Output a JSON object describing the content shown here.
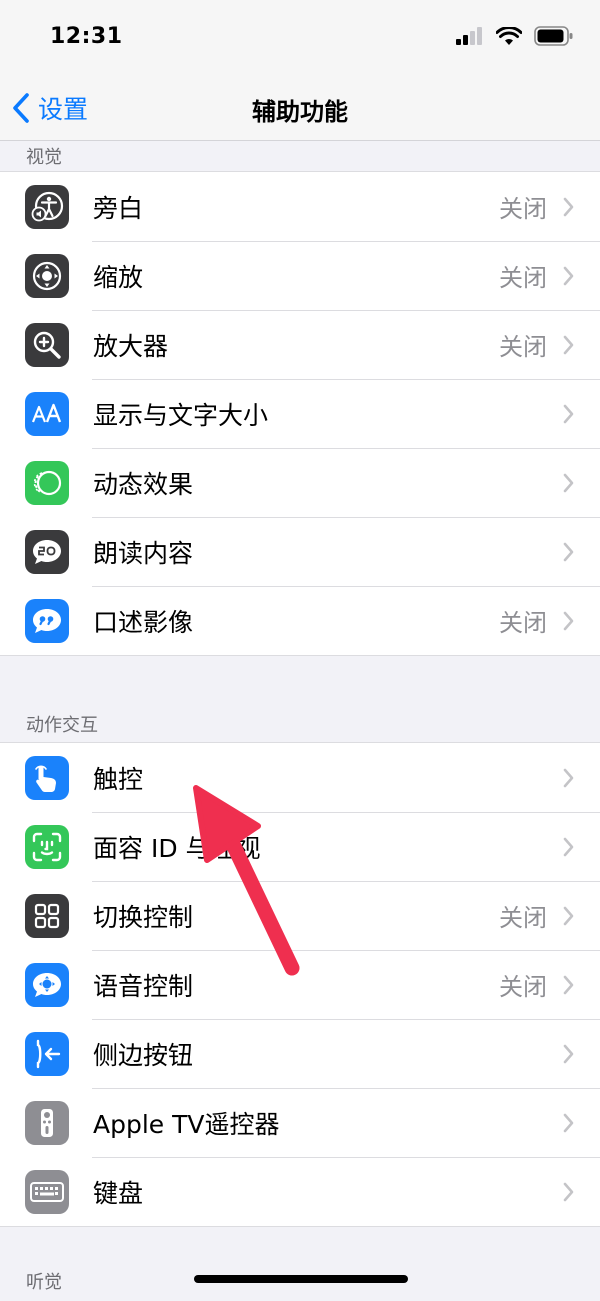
{
  "status": {
    "time": "12:31"
  },
  "nav": {
    "back_label": "设置",
    "title": "辅助功能"
  },
  "sections": [
    {
      "header": "视觉",
      "rows": [
        {
          "label": "旁白",
          "value": "关闭",
          "icon": "voiceover-icon",
          "color": "#3a3a3c"
        },
        {
          "label": "缩放",
          "value": "关闭",
          "icon": "zoom-icon",
          "color": "#3a3a3c"
        },
        {
          "label": "放大器",
          "value": "关闭",
          "icon": "magnifier-icon",
          "color": "#3a3a3c"
        },
        {
          "label": "显示与文字大小",
          "value": "",
          "icon": "text-size-icon",
          "color": "#1a82fb"
        },
        {
          "label": "动态效果",
          "value": "",
          "icon": "motion-icon",
          "color": "#34c759"
        },
        {
          "label": "朗读内容",
          "value": "",
          "icon": "speech-bubble-icon",
          "color": "#3a3a3c"
        },
        {
          "label": "口述影像",
          "value": "关闭",
          "icon": "audio-description-icon",
          "color": "#1a82fb"
        }
      ]
    },
    {
      "header": "动作交互",
      "rows": [
        {
          "label": "触控",
          "value": "",
          "icon": "touch-hand-icon",
          "color": "#1a82fb"
        },
        {
          "label": "面容 ID 与注视",
          "value": "",
          "icon": "face-id-icon",
          "color": "#34c759"
        },
        {
          "label": "切换控制",
          "value": "关闭",
          "icon": "switch-control-icon",
          "color": "#3a3a3c"
        },
        {
          "label": "语音控制",
          "value": "关闭",
          "icon": "voice-control-icon",
          "color": "#1a82fb"
        },
        {
          "label": "侧边按钮",
          "value": "",
          "icon": "side-button-icon",
          "color": "#1a82fb"
        },
        {
          "label": "Apple TV遥控器",
          "value": "",
          "icon": "tv-remote-icon",
          "color": "#8e8e93"
        },
        {
          "label": "键盘",
          "value": "",
          "icon": "keyboard-icon",
          "color": "#8e8e93"
        }
      ]
    },
    {
      "header": "听觉",
      "rows": []
    }
  ],
  "colors": {
    "accent": "#0a7aff",
    "annotation_arrow": "#ef2f4f"
  }
}
